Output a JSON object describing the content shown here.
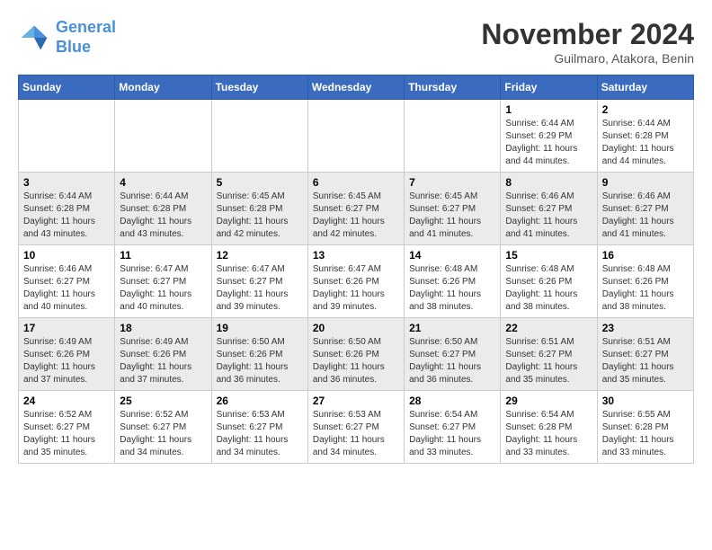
{
  "logo": {
    "line1": "General",
    "line2": "Blue"
  },
  "title": "November 2024",
  "location": "Guilmaro, Atakora, Benin",
  "weekdays": [
    "Sunday",
    "Monday",
    "Tuesday",
    "Wednesday",
    "Thursday",
    "Friday",
    "Saturday"
  ],
  "weeks": [
    [
      {
        "day": "",
        "info": ""
      },
      {
        "day": "",
        "info": ""
      },
      {
        "day": "",
        "info": ""
      },
      {
        "day": "",
        "info": ""
      },
      {
        "day": "",
        "info": ""
      },
      {
        "day": "1",
        "info": "Sunrise: 6:44 AM\nSunset: 6:29 PM\nDaylight: 11 hours and 44 minutes."
      },
      {
        "day": "2",
        "info": "Sunrise: 6:44 AM\nSunset: 6:28 PM\nDaylight: 11 hours and 44 minutes."
      }
    ],
    [
      {
        "day": "3",
        "info": "Sunrise: 6:44 AM\nSunset: 6:28 PM\nDaylight: 11 hours and 43 minutes."
      },
      {
        "day": "4",
        "info": "Sunrise: 6:44 AM\nSunset: 6:28 PM\nDaylight: 11 hours and 43 minutes."
      },
      {
        "day": "5",
        "info": "Sunrise: 6:45 AM\nSunset: 6:28 PM\nDaylight: 11 hours and 42 minutes."
      },
      {
        "day": "6",
        "info": "Sunrise: 6:45 AM\nSunset: 6:27 PM\nDaylight: 11 hours and 42 minutes."
      },
      {
        "day": "7",
        "info": "Sunrise: 6:45 AM\nSunset: 6:27 PM\nDaylight: 11 hours and 41 minutes."
      },
      {
        "day": "8",
        "info": "Sunrise: 6:46 AM\nSunset: 6:27 PM\nDaylight: 11 hours and 41 minutes."
      },
      {
        "day": "9",
        "info": "Sunrise: 6:46 AM\nSunset: 6:27 PM\nDaylight: 11 hours and 41 minutes."
      }
    ],
    [
      {
        "day": "10",
        "info": "Sunrise: 6:46 AM\nSunset: 6:27 PM\nDaylight: 11 hours and 40 minutes."
      },
      {
        "day": "11",
        "info": "Sunrise: 6:47 AM\nSunset: 6:27 PM\nDaylight: 11 hours and 40 minutes."
      },
      {
        "day": "12",
        "info": "Sunrise: 6:47 AM\nSunset: 6:27 PM\nDaylight: 11 hours and 39 minutes."
      },
      {
        "day": "13",
        "info": "Sunrise: 6:47 AM\nSunset: 6:26 PM\nDaylight: 11 hours and 39 minutes."
      },
      {
        "day": "14",
        "info": "Sunrise: 6:48 AM\nSunset: 6:26 PM\nDaylight: 11 hours and 38 minutes."
      },
      {
        "day": "15",
        "info": "Sunrise: 6:48 AM\nSunset: 6:26 PM\nDaylight: 11 hours and 38 minutes."
      },
      {
        "day": "16",
        "info": "Sunrise: 6:48 AM\nSunset: 6:26 PM\nDaylight: 11 hours and 38 minutes."
      }
    ],
    [
      {
        "day": "17",
        "info": "Sunrise: 6:49 AM\nSunset: 6:26 PM\nDaylight: 11 hours and 37 minutes."
      },
      {
        "day": "18",
        "info": "Sunrise: 6:49 AM\nSunset: 6:26 PM\nDaylight: 11 hours and 37 minutes."
      },
      {
        "day": "19",
        "info": "Sunrise: 6:50 AM\nSunset: 6:26 PM\nDaylight: 11 hours and 36 minutes."
      },
      {
        "day": "20",
        "info": "Sunrise: 6:50 AM\nSunset: 6:26 PM\nDaylight: 11 hours and 36 minutes."
      },
      {
        "day": "21",
        "info": "Sunrise: 6:50 AM\nSunset: 6:27 PM\nDaylight: 11 hours and 36 minutes."
      },
      {
        "day": "22",
        "info": "Sunrise: 6:51 AM\nSunset: 6:27 PM\nDaylight: 11 hours and 35 minutes."
      },
      {
        "day": "23",
        "info": "Sunrise: 6:51 AM\nSunset: 6:27 PM\nDaylight: 11 hours and 35 minutes."
      }
    ],
    [
      {
        "day": "24",
        "info": "Sunrise: 6:52 AM\nSunset: 6:27 PM\nDaylight: 11 hours and 35 minutes."
      },
      {
        "day": "25",
        "info": "Sunrise: 6:52 AM\nSunset: 6:27 PM\nDaylight: 11 hours and 34 minutes."
      },
      {
        "day": "26",
        "info": "Sunrise: 6:53 AM\nSunset: 6:27 PM\nDaylight: 11 hours and 34 minutes."
      },
      {
        "day": "27",
        "info": "Sunrise: 6:53 AM\nSunset: 6:27 PM\nDaylight: 11 hours and 34 minutes."
      },
      {
        "day": "28",
        "info": "Sunrise: 6:54 AM\nSunset: 6:27 PM\nDaylight: 11 hours and 33 minutes."
      },
      {
        "day": "29",
        "info": "Sunrise: 6:54 AM\nSunset: 6:28 PM\nDaylight: 11 hours and 33 minutes."
      },
      {
        "day": "30",
        "info": "Sunrise: 6:55 AM\nSunset: 6:28 PM\nDaylight: 11 hours and 33 minutes."
      }
    ]
  ]
}
